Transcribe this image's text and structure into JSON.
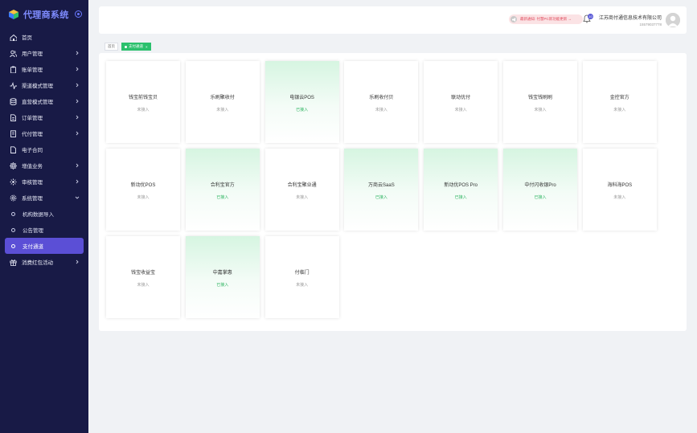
{
  "brand": {
    "title": "代理商系统"
  },
  "sidebar": {
    "items": [
      {
        "label": "首页",
        "icon": "home-icon",
        "chevron": false
      },
      {
        "label": "用户管理",
        "icon": "users-icon",
        "chevron": true
      },
      {
        "label": "账单管理",
        "icon": "clipboard-icon",
        "chevron": true
      },
      {
        "label": "渠道模式管理",
        "icon": "activity-icon",
        "chevron": true
      },
      {
        "label": "直营模式管理",
        "icon": "database-icon",
        "chevron": true
      },
      {
        "label": "订单管理",
        "icon": "document-icon",
        "chevron": true
      },
      {
        "label": "代付管理",
        "icon": "document-list-icon",
        "chevron": true
      },
      {
        "label": "电子合同",
        "icon": "file-icon",
        "chevron": false
      },
      {
        "label": "增值业务",
        "icon": "gear-flower-icon",
        "chevron": true
      },
      {
        "label": "审核管理",
        "icon": "settings-icon",
        "chevron": true
      },
      {
        "label": "系统管理",
        "icon": "cog-icon",
        "chevron": true,
        "expanded": true
      }
    ],
    "subitems": [
      {
        "label": "机构数据导入",
        "active": false
      },
      {
        "label": "公告管理",
        "active": false
      },
      {
        "label": "支付通道",
        "active": true
      }
    ],
    "after": {
      "label": "消费红包活动",
      "icon": "gift-icon",
      "chevron": true
    }
  },
  "header": {
    "notice": "最新通知: 付慧PC新功能更新 →",
    "bell_count": "10",
    "company_name": "江苏商付通信息技术有限公司",
    "company_phone": "15579037778"
  },
  "tabs": [
    {
      "label": "首页",
      "active": false
    },
    {
      "label": "支付通道",
      "active": true,
      "closable": "×"
    }
  ],
  "channels": [
    {
      "name": "钱宝前钱宝贝",
      "status": "未接入",
      "connected": false
    },
    {
      "name": "乐刷聚收付",
      "status": "未接入",
      "connected": false
    },
    {
      "name": "电银云POS",
      "status": "已接入",
      "connected": true
    },
    {
      "name": "乐刷收付贝",
      "status": "未接入",
      "connected": false
    },
    {
      "name": "联动优付",
      "status": "未接入",
      "connected": false
    },
    {
      "name": "钱宝钱刷刷",
      "status": "未接入",
      "connected": false
    },
    {
      "name": "金控官方",
      "status": "未接入",
      "connected": false
    },
    {
      "name": "新动优POS",
      "status": "未接入",
      "connected": false
    },
    {
      "name": "合利宝官方",
      "status": "已接入",
      "connected": true
    },
    {
      "name": "合利宝聚业通",
      "status": "未接入",
      "connected": false
    },
    {
      "name": "万商云SaaS",
      "status": "已接入",
      "connected": true
    },
    {
      "name": "新动优POS Pro",
      "status": "已接入",
      "connected": true
    },
    {
      "name": "中付闪收银Pro",
      "status": "已接入",
      "connected": true
    },
    {
      "name": "海科海POS",
      "status": "未接入",
      "connected": false
    },
    {
      "name": "钱宝收益宝",
      "status": "未接入",
      "connected": false
    },
    {
      "name": "中嘉掌惠",
      "status": "已接入",
      "connected": true
    },
    {
      "name": "付临门",
      "status": "未接入",
      "connected": false
    }
  ],
  "colors": {
    "sidebar_bg": "#181a46",
    "accent": "#5b4fd6",
    "connected": "#2bb35f",
    "tab_active": "#2bc06d"
  }
}
